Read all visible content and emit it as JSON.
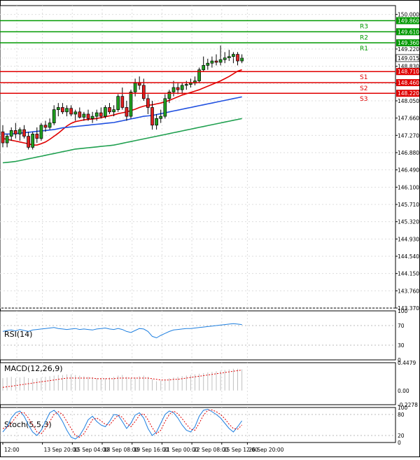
{
  "chart_data": {
    "type": "candlestick",
    "instrument_panels": [
      {
        "id": "price",
        "y_ticks": [
          "150.000",
          "149.610",
          "149.220",
          "148.830",
          "148.440",
          "148.050",
          "147.660",
          "147.270",
          "146.880",
          "146.490",
          "146.100",
          "145.710",
          "145.320",
          "144.930",
          "144.540",
          "144.150",
          "143.760",
          "143.370"
        ],
        "ylim": [
          143.37,
          150.2
        ],
        "current_price": "149.015",
        "levels": [
          {
            "name": "R3",
            "value": 149.86,
            "label": "149.860",
            "color": "#009900"
          },
          {
            "name": "R2",
            "value": 149.61,
            "label": "149.610",
            "color": "#009900"
          },
          {
            "name": "R1",
            "value": 149.36,
            "label": "149.360",
            "color": "#009900"
          },
          {
            "name": "S1",
            "value": 148.71,
            "label": "148.710",
            "color": "#e00000"
          },
          {
            "name": "S2",
            "value": 148.46,
            "label": "148.460",
            "color": "#e00000"
          },
          {
            "name": "S3",
            "value": 148.22,
            "label": "148.220",
            "color": "#e00000"
          }
        ],
        "candles": [
          {
            "o": 147.35,
            "h": 147.5,
            "l": 147.0,
            "c": 147.1
          },
          {
            "o": 147.1,
            "h": 147.3,
            "l": 147.0,
            "c": 147.25
          },
          {
            "o": 147.25,
            "h": 147.45,
            "l": 147.15,
            "c": 147.38
          },
          {
            "o": 147.38,
            "h": 147.55,
            "l": 147.2,
            "c": 147.3
          },
          {
            "o": 147.3,
            "h": 147.45,
            "l": 147.15,
            "c": 147.4
          },
          {
            "o": 147.4,
            "h": 147.5,
            "l": 147.2,
            "c": 147.25
          },
          {
            "o": 147.25,
            "h": 147.35,
            "l": 146.95,
            "c": 147.0
          },
          {
            "o": 147.0,
            "h": 147.35,
            "l": 146.95,
            "c": 147.3
          },
          {
            "o": 147.3,
            "h": 147.45,
            "l": 147.1,
            "c": 147.2
          },
          {
            "o": 147.2,
            "h": 147.55,
            "l": 147.15,
            "c": 147.5
          },
          {
            "o": 147.5,
            "h": 147.6,
            "l": 147.35,
            "c": 147.45
          },
          {
            "o": 147.45,
            "h": 147.65,
            "l": 147.4,
            "c": 147.55
          },
          {
            "o": 147.55,
            "h": 147.95,
            "l": 147.5,
            "c": 147.85
          },
          {
            "o": 147.85,
            "h": 148.0,
            "l": 147.7,
            "c": 147.9
          },
          {
            "o": 147.9,
            "h": 148.0,
            "l": 147.75,
            "c": 147.8
          },
          {
            "o": 147.8,
            "h": 147.95,
            "l": 147.7,
            "c": 147.88
          },
          {
            "o": 147.88,
            "h": 147.95,
            "l": 147.7,
            "c": 147.75
          },
          {
            "o": 147.75,
            "h": 147.85,
            "l": 147.6,
            "c": 147.8
          },
          {
            "o": 147.8,
            "h": 147.9,
            "l": 147.65,
            "c": 147.68
          },
          {
            "o": 147.68,
            "h": 147.8,
            "l": 147.6,
            "c": 147.75
          },
          {
            "o": 147.75,
            "h": 147.85,
            "l": 147.6,
            "c": 147.65
          },
          {
            "o": 147.65,
            "h": 147.8,
            "l": 147.55,
            "c": 147.7
          },
          {
            "o": 147.7,
            "h": 147.85,
            "l": 147.6,
            "c": 147.78
          },
          {
            "o": 147.78,
            "h": 147.9,
            "l": 147.65,
            "c": 147.7
          },
          {
            "o": 147.7,
            "h": 147.95,
            "l": 147.65,
            "c": 147.9
          },
          {
            "o": 147.9,
            "h": 148.0,
            "l": 147.75,
            "c": 147.8
          },
          {
            "o": 147.8,
            "h": 147.95,
            "l": 147.7,
            "c": 147.85
          },
          {
            "o": 147.85,
            "h": 148.2,
            "l": 147.8,
            "c": 148.15
          },
          {
            "o": 148.15,
            "h": 148.35,
            "l": 147.85,
            "c": 147.9
          },
          {
            "o": 147.9,
            "h": 148.05,
            "l": 147.6,
            "c": 147.7
          },
          {
            "o": 147.7,
            "h": 148.3,
            "l": 147.65,
            "c": 148.25
          },
          {
            "o": 148.25,
            "h": 148.55,
            "l": 148.15,
            "c": 148.45
          },
          {
            "o": 148.45,
            "h": 148.6,
            "l": 148.3,
            "c": 148.4
          },
          {
            "o": 148.4,
            "h": 148.55,
            "l": 148.05,
            "c": 148.1
          },
          {
            "o": 148.1,
            "h": 148.2,
            "l": 147.75,
            "c": 147.9
          },
          {
            "o": 147.9,
            "h": 148.05,
            "l": 147.4,
            "c": 147.5
          },
          {
            "o": 147.5,
            "h": 147.75,
            "l": 147.4,
            "c": 147.65
          },
          {
            "o": 147.65,
            "h": 147.85,
            "l": 147.55,
            "c": 147.7
          },
          {
            "o": 147.7,
            "h": 148.2,
            "l": 147.65,
            "c": 148.1
          },
          {
            "o": 148.1,
            "h": 148.3,
            "l": 148.0,
            "c": 148.25
          },
          {
            "o": 148.25,
            "h": 148.5,
            "l": 148.15,
            "c": 148.35
          },
          {
            "o": 148.35,
            "h": 148.45,
            "l": 148.2,
            "c": 148.3
          },
          {
            "o": 148.3,
            "h": 148.45,
            "l": 148.2,
            "c": 148.4
          },
          {
            "o": 148.4,
            "h": 148.5,
            "l": 148.3,
            "c": 148.42
          },
          {
            "o": 148.42,
            "h": 148.55,
            "l": 148.35,
            "c": 148.45
          },
          {
            "o": 148.45,
            "h": 148.6,
            "l": 148.4,
            "c": 148.5
          },
          {
            "o": 148.5,
            "h": 148.8,
            "l": 148.45,
            "c": 148.75
          },
          {
            "o": 148.75,
            "h": 149.05,
            "l": 148.7,
            "c": 148.85
          },
          {
            "o": 148.85,
            "h": 149.0,
            "l": 148.75,
            "c": 148.9
          },
          {
            "o": 148.9,
            "h": 149.05,
            "l": 148.8,
            "c": 148.95
          },
          {
            "o": 148.95,
            "h": 149.1,
            "l": 148.85,
            "c": 148.92
          },
          {
            "o": 148.92,
            "h": 149.3,
            "l": 148.85,
            "c": 148.98
          },
          {
            "o": 148.98,
            "h": 149.15,
            "l": 148.9,
            "c": 149.02
          },
          {
            "o": 149.02,
            "h": 149.2,
            "l": 148.95,
            "c": 149.05
          },
          {
            "o": 149.05,
            "h": 149.15,
            "l": 148.9,
            "c": 149.1
          },
          {
            "o": 149.1,
            "h": 149.15,
            "l": 148.85,
            "c": 148.95
          },
          {
            "o": 148.95,
            "h": 149.1,
            "l": 148.9,
            "c": 149.015
          }
        ],
        "moving_averages": [
          {
            "color": "#e00000",
            "values": [
              147.2,
              147.18,
              147.16,
              147.14,
              147.12,
              147.1,
              147.08,
              147.05,
              147.05,
              147.08,
              147.12,
              147.18,
              147.25,
              147.32,
              147.4,
              147.48,
              147.54,
              147.58,
              147.6,
              147.62,
              147.63,
              147.64,
              147.65,
              147.67,
              147.69,
              147.71,
              147.73,
              147.76,
              147.78,
              147.8,
              147.83,
              147.86,
              147.9,
              147.93,
              147.95,
              147.96,
              147.98,
              148.0,
              148.03,
              148.06,
              148.1,
              148.14,
              148.18,
              148.21,
              148.24,
              148.27,
              148.3,
              148.34,
              148.38,
              148.42,
              148.46,
              148.5,
              148.55,
              148.6,
              148.66,
              148.72,
              148.75
            ]
          },
          {
            "color": "#2050e0",
            "values": [
              147.3,
              147.3,
              147.3,
              147.31,
              147.32,
              147.33,
              147.34,
              147.35,
              147.36,
              147.37,
              147.38,
              147.39,
              147.4,
              147.42,
              147.44,
              147.45,
              147.46,
              147.47,
              147.48,
              147.49,
              147.5,
              147.51,
              147.52,
              147.53,
              147.54,
              147.55,
              147.56,
              147.58,
              147.6,
              147.62,
              147.64,
              147.66,
              147.68,
              147.7,
              147.71,
              147.72,
              147.74,
              147.76,
              147.78,
              147.8,
              147.82,
              147.84,
              147.86,
              147.88,
              147.9,
              147.92,
              147.94,
              147.96,
              147.98,
              148.0,
              148.02,
              148.04,
              148.06,
              148.08,
              148.1,
              148.12,
              148.14
            ]
          },
          {
            "color": "#20a050",
            "values": [
              146.65,
              146.66,
              146.67,
              146.68,
              146.7,
              146.72,
              146.74,
              146.76,
              146.78,
              146.8,
              146.82,
              146.84,
              146.86,
              146.88,
              146.9,
              146.92,
              146.94,
              146.96,
              146.97,
              146.98,
              146.99,
              147.0,
              147.01,
              147.02,
              147.03,
              147.04,
              147.05,
              147.07,
              147.09,
              147.11,
              147.13,
              147.15,
              147.17,
              147.19,
              147.21,
              147.23,
              147.25,
              147.27,
              147.29,
              147.31,
              147.33,
              147.35,
              147.37,
              147.39,
              147.41,
              147.43,
              147.45,
              147.47,
              147.49,
              147.51,
              147.53,
              147.55,
              147.57,
              147.59,
              147.61,
              147.63,
              147.65
            ]
          }
        ]
      },
      {
        "id": "rsi",
        "label": "RSI(14)",
        "y_ticks": [
          "100",
          "70",
          "30",
          "0"
        ],
        "ylim": [
          0,
          100
        ],
        "color": "#2080e0",
        "values": [
          58,
          60,
          61,
          59,
          62,
          60,
          58,
          61,
          62,
          63,
          64,
          65,
          66,
          64,
          63,
          62,
          63,
          64,
          62,
          63,
          62,
          61,
          63,
          64,
          65,
          63,
          62,
          64,
          62,
          58,
          56,
          60,
          64,
          63,
          58,
          48,
          45,
          50,
          54,
          58,
          61,
          62,
          63,
          64,
          64,
          65,
          66,
          67,
          68,
          69,
          70,
          71,
          72,
          73,
          74,
          73,
          72
        ]
      },
      {
        "id": "macd",
        "label": "MACD(12,26,9)",
        "y_ticks": [
          "0.4479",
          "0.00",
          "-0.2278"
        ],
        "ylim": [
          -0.2278,
          0.4479
        ],
        "hist_color": "#c0c0c0",
        "signal_color": "#e00000",
        "values": [
          0.2,
          0.21,
          0.22,
          0.2,
          0.21,
          0.22,
          0.2,
          0.19,
          0.2,
          0.21,
          0.22,
          0.23,
          0.24,
          0.25,
          0.25,
          0.26,
          0.26,
          0.25,
          0.24,
          0.23,
          0.22,
          0.21,
          0.2,
          0.2,
          0.2,
          0.21,
          0.22,
          0.24,
          0.25,
          0.22,
          0.2,
          0.21,
          0.23,
          0.24,
          0.22,
          0.18,
          0.15,
          0.16,
          0.18,
          0.2,
          0.21,
          0.22,
          0.23,
          0.24,
          0.25,
          0.26,
          0.27,
          0.28,
          0.29,
          0.3,
          0.31,
          0.32,
          0.33,
          0.34,
          0.35,
          0.35,
          0.34
        ],
        "signal": [
          0.05,
          0.06,
          0.07,
          0.08,
          0.09,
          0.1,
          0.11,
          0.12,
          0.13,
          0.14,
          0.15,
          0.16,
          0.17,
          0.18,
          0.19,
          0.2,
          0.2,
          0.2,
          0.2,
          0.2,
          0.2,
          0.2,
          0.19,
          0.19,
          0.19,
          0.19,
          0.19,
          0.2,
          0.2,
          0.2,
          0.2,
          0.2,
          0.2,
          0.2,
          0.2,
          0.19,
          0.18,
          0.17,
          0.17,
          0.17,
          0.18,
          0.18,
          0.19,
          0.2,
          0.21,
          0.22,
          0.23,
          0.24,
          0.25,
          0.26,
          0.27,
          0.28,
          0.29,
          0.3,
          0.31,
          0.32,
          0.33
        ]
      },
      {
        "id": "stoch",
        "label": "Stoch(5,5,3)",
        "y_ticks": [
          "100",
          "80",
          "20",
          "0"
        ],
        "ylim": [
          0,
          100
        ],
        "main_color": "#2080e0",
        "signal_color": "#e00000",
        "main": [
          30,
          45,
          70,
          85,
          90,
          75,
          50,
          30,
          20,
          35,
          60,
          85,
          92,
          80,
          60,
          35,
          15,
          10,
          20,
          40,
          65,
          75,
          60,
          50,
          45,
          60,
          80,
          78,
          60,
          40,
          55,
          78,
          85,
          70,
          40,
          20,
          30,
          55,
          80,
          90,
          85,
          70,
          50,
          35,
          30,
          45,
          75,
          92,
          95,
          88,
          80,
          70,
          55,
          40,
          30,
          45,
          62
        ],
        "signal": [
          40,
          42,
          55,
          72,
          85,
          85,
          70,
          50,
          30,
          25,
          40,
          60,
          80,
          88,
          80,
          60,
          40,
          20,
          15,
          25,
          45,
          65,
          70,
          62,
          52,
          50,
          65,
          78,
          72,
          55,
          45,
          60,
          78,
          82,
          65,
          42,
          25,
          35,
          60,
          80,
          90,
          82,
          68,
          52,
          38,
          35,
          55,
          78,
          92,
          93,
          88,
          80,
          68,
          52,
          40,
          38,
          50
        ]
      }
    ],
    "x_tick_labels": [
      "12:00",
      "13 Sep 20:00",
      "15 Sep 04:00",
      "18 Sep 08:00",
      "19 Sep 16:00",
      "21 Sep 00:00",
      "22 Sep 08:00",
      "25 Sep 12:00",
      "26 Sep 20:00"
    ],
    "x_tick_candle_index": [
      0,
      6,
      13,
      20,
      27,
      34,
      41,
      48,
      54
    ]
  }
}
